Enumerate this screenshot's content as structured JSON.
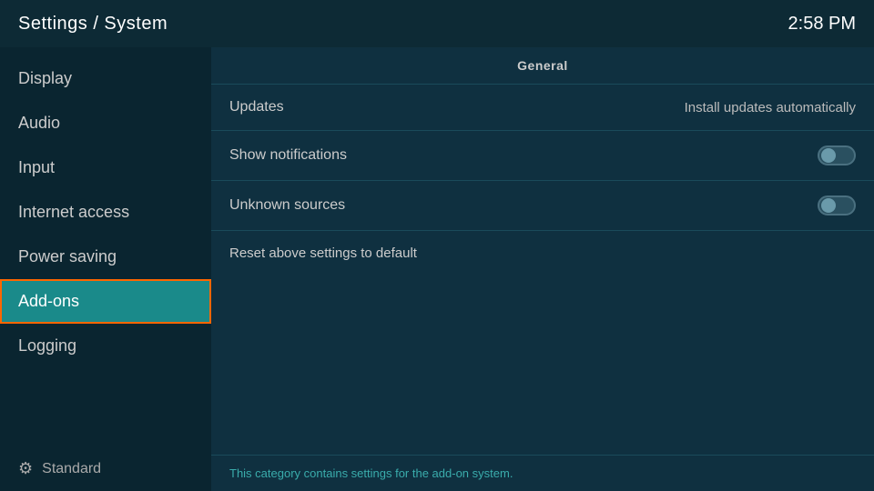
{
  "header": {
    "title": "Settings / System",
    "time": "2:58 PM"
  },
  "sidebar": {
    "items": [
      {
        "id": "display",
        "label": "Display",
        "active": false
      },
      {
        "id": "audio",
        "label": "Audio",
        "active": false
      },
      {
        "id": "input",
        "label": "Input",
        "active": false
      },
      {
        "id": "internet-access",
        "label": "Internet access",
        "active": false
      },
      {
        "id": "power-saving",
        "label": "Power saving",
        "active": false
      },
      {
        "id": "add-ons",
        "label": "Add-ons",
        "active": true
      },
      {
        "id": "logging",
        "label": "Logging",
        "active": false
      }
    ],
    "footer": {
      "icon": "⚙",
      "label": "Standard"
    }
  },
  "content": {
    "section_header": "General",
    "rows": [
      {
        "id": "updates",
        "label": "Updates",
        "value": "Install updates automatically",
        "type": "text"
      },
      {
        "id": "show-notifications",
        "label": "Show notifications",
        "value": "",
        "type": "toggle"
      },
      {
        "id": "unknown-sources",
        "label": "Unknown sources",
        "value": "",
        "type": "toggle"
      },
      {
        "id": "reset-settings",
        "label": "Reset above settings to default",
        "value": "",
        "type": "reset"
      }
    ],
    "footer_text": "This category contains settings for the add-on system."
  }
}
